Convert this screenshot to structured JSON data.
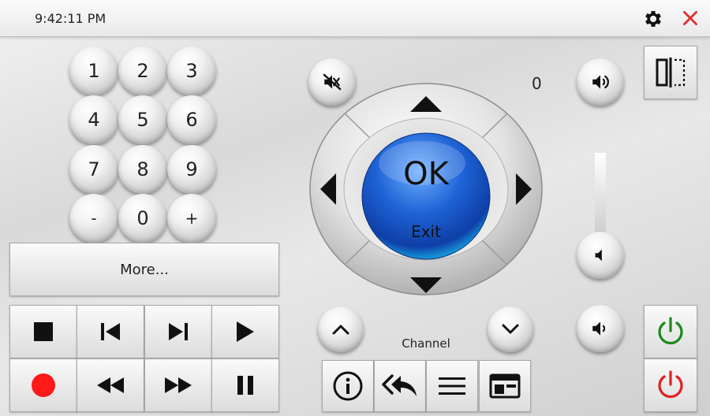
{
  "header": {
    "time": "9:42:11 PM"
  },
  "keypad": [
    "1",
    "2",
    "3",
    "4",
    "5",
    "6",
    "7",
    "8",
    "9",
    "-",
    "0",
    "+"
  ],
  "more_label": "More...",
  "dpad": {
    "ok": "OK",
    "exit": "Exit"
  },
  "volume_value": "0",
  "channel_label": "Channel",
  "colors": {
    "record": "#ff1a1a",
    "power_on": "#1a8a1a",
    "power_off": "#e02020",
    "ok_blue": "#1e63d6",
    "close": "#e03030"
  }
}
